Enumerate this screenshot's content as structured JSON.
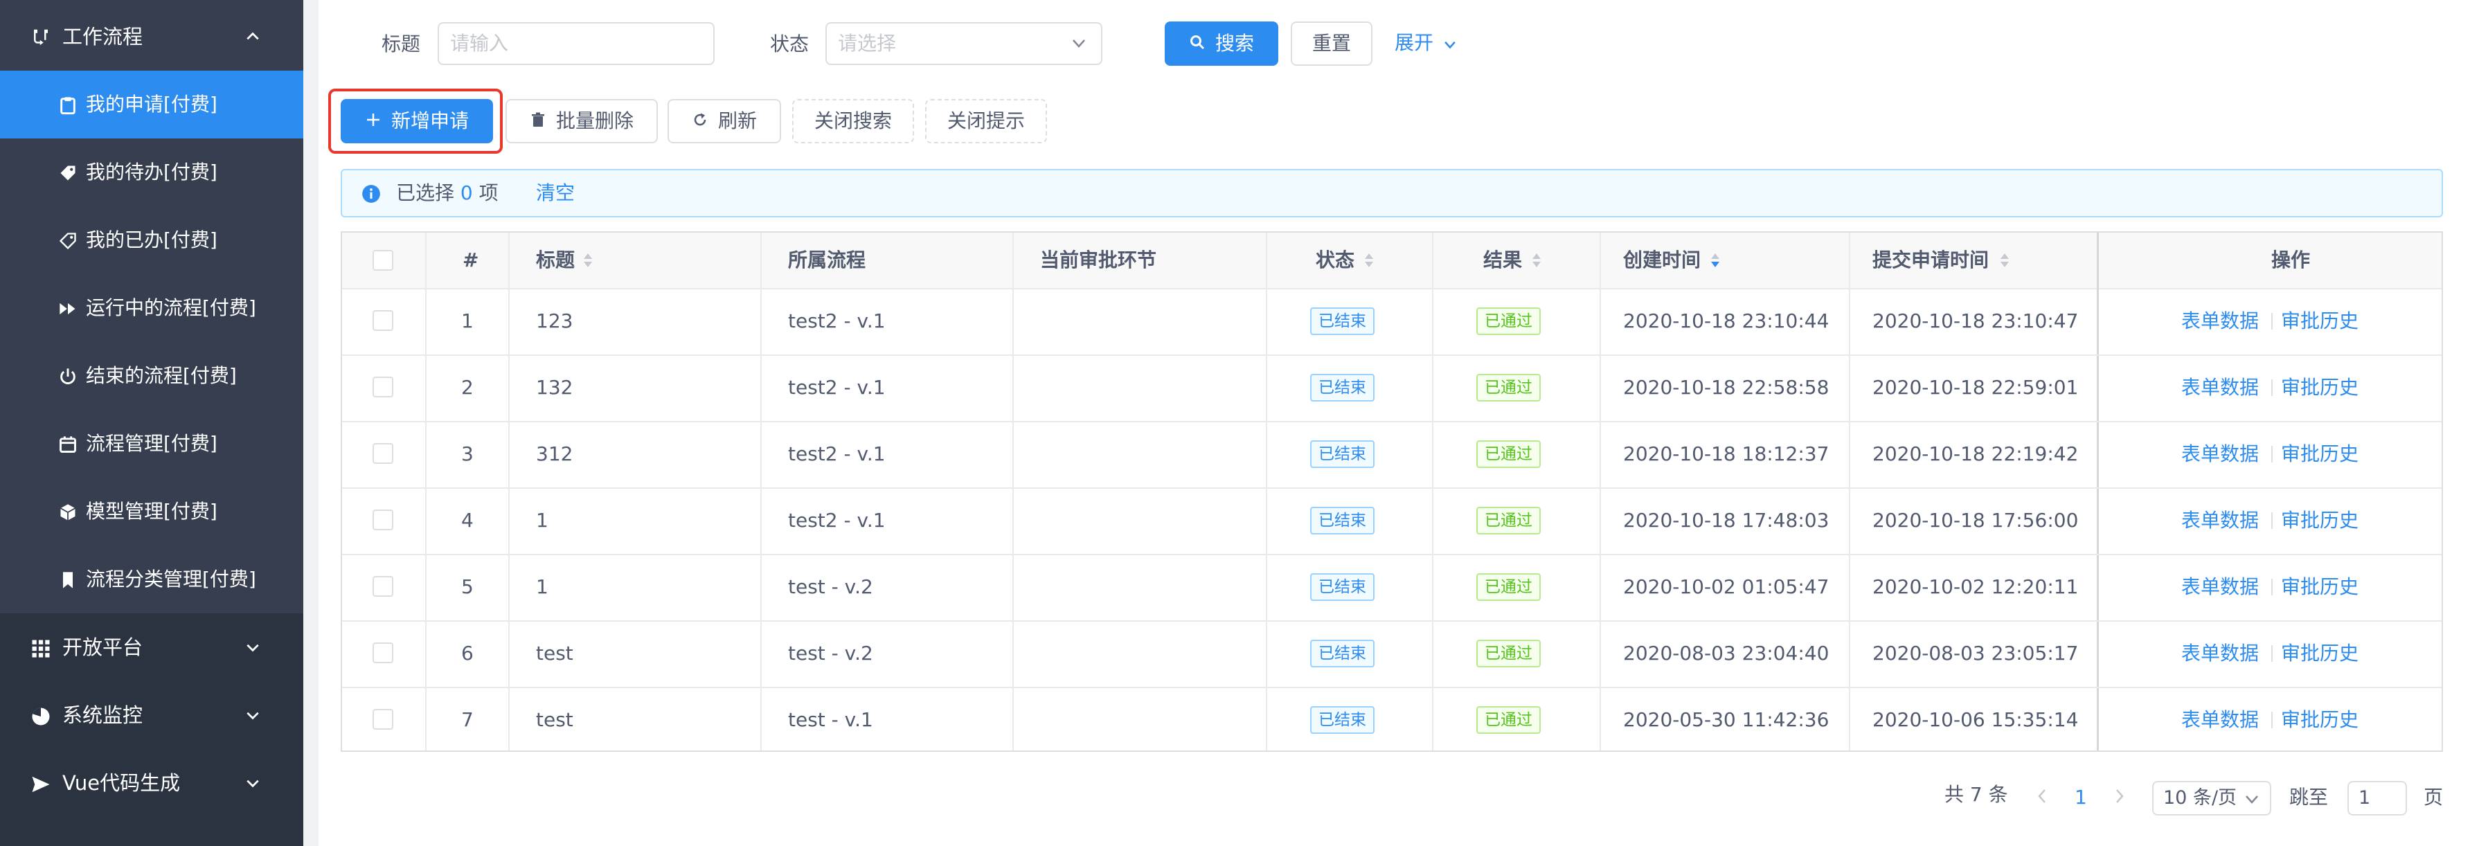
{
  "sidebar": {
    "group_workflow": {
      "label": "工作流程",
      "icon": "workflow-icon"
    },
    "items": [
      {
        "label": "我的申请[付费]",
        "icon": "clipboard-icon",
        "active": true
      },
      {
        "label": "我的待办[付费]",
        "icon": "tag-icon"
      },
      {
        "label": "我的已办[付费]",
        "icon": "tag-outline-icon"
      },
      {
        "label": "运行中的流程[付费]",
        "icon": "fast-forward-icon"
      },
      {
        "label": "结束的流程[付费]",
        "icon": "power-icon"
      },
      {
        "label": "流程管理[付费]",
        "icon": "calendar-icon"
      },
      {
        "label": "模型管理[付费]",
        "icon": "cube-icon"
      },
      {
        "label": "流程分类管理[付费]",
        "icon": "bookmark-icon"
      }
    ],
    "groups": [
      {
        "label": "开放平台",
        "icon": "grid-icon"
      },
      {
        "label": "系统监控",
        "icon": "pie-chart-icon"
      },
      {
        "label": "Vue代码生成",
        "icon": "send-icon"
      }
    ]
  },
  "search": {
    "title_label": "标题",
    "title_placeholder": "请输入",
    "status_label": "状态",
    "status_placeholder": "请选择",
    "search_button": "搜索",
    "reset_button": "重置",
    "expand_link": "展开"
  },
  "toolbar": {
    "add": "新增申请",
    "batch_delete": "批量删除",
    "refresh": "刷新",
    "close_search": "关闭搜索",
    "close_tip": "关闭提示"
  },
  "alert": {
    "prefix": "已选择",
    "count": "0",
    "suffix": "项",
    "clear": "清空"
  },
  "table": {
    "columns": [
      "#",
      "标题",
      "所属流程",
      "当前审批环节",
      "状态",
      "结果",
      "创建时间",
      "提交申请时间",
      "操作"
    ],
    "rows": [
      {
        "index": "1",
        "title": "123",
        "process": "test2 - v.1",
        "node": "",
        "status": "已结束",
        "result": "已通过",
        "created": "2020-10-18 23:10:44",
        "submitted": "2020-10-18 23:10:47"
      },
      {
        "index": "2",
        "title": "132",
        "process": "test2 - v.1",
        "node": "",
        "status": "已结束",
        "result": "已通过",
        "created": "2020-10-18 22:58:58",
        "submitted": "2020-10-18 22:59:01"
      },
      {
        "index": "3",
        "title": "312",
        "process": "test2 - v.1",
        "node": "",
        "status": "已结束",
        "result": "已通过",
        "created": "2020-10-18 18:12:37",
        "submitted": "2020-10-18 22:19:42"
      },
      {
        "index": "4",
        "title": "1",
        "process": "test2 - v.1",
        "node": "",
        "status": "已结束",
        "result": "已通过",
        "created": "2020-10-18 17:48:03",
        "submitted": "2020-10-18 17:56:00"
      },
      {
        "index": "5",
        "title": "1",
        "process": "test - v.2",
        "node": "",
        "status": "已结束",
        "result": "已通过",
        "created": "2020-10-02 01:05:47",
        "submitted": "2020-10-02 12:20:11"
      },
      {
        "index": "6",
        "title": "test",
        "process": "test - v.2",
        "node": "",
        "status": "已结束",
        "result": "已通过",
        "created": "2020-08-03 23:04:40",
        "submitted": "2020-08-03 23:05:17"
      },
      {
        "index": "7",
        "title": "test",
        "process": "test - v.1",
        "node": "",
        "status": "已结束",
        "result": "已通过",
        "created": "2020-05-30 11:42:36",
        "submitted": "2020-10-06 15:35:14"
      }
    ],
    "actions": {
      "form_data": "表单数据",
      "history": "审批历史"
    }
  },
  "pagination": {
    "total": "共 7 条",
    "current_page": "1",
    "page_size": "10 条/页",
    "jump_label": "跳至",
    "jump_value": "1",
    "page_unit": "页"
  },
  "colors": {
    "sidebar_bg": "#363e4f",
    "active": "#2d8cf0",
    "highlight": "#e8372b",
    "tag_blue": "#2d8cf0",
    "tag_green": "#52c41a"
  }
}
